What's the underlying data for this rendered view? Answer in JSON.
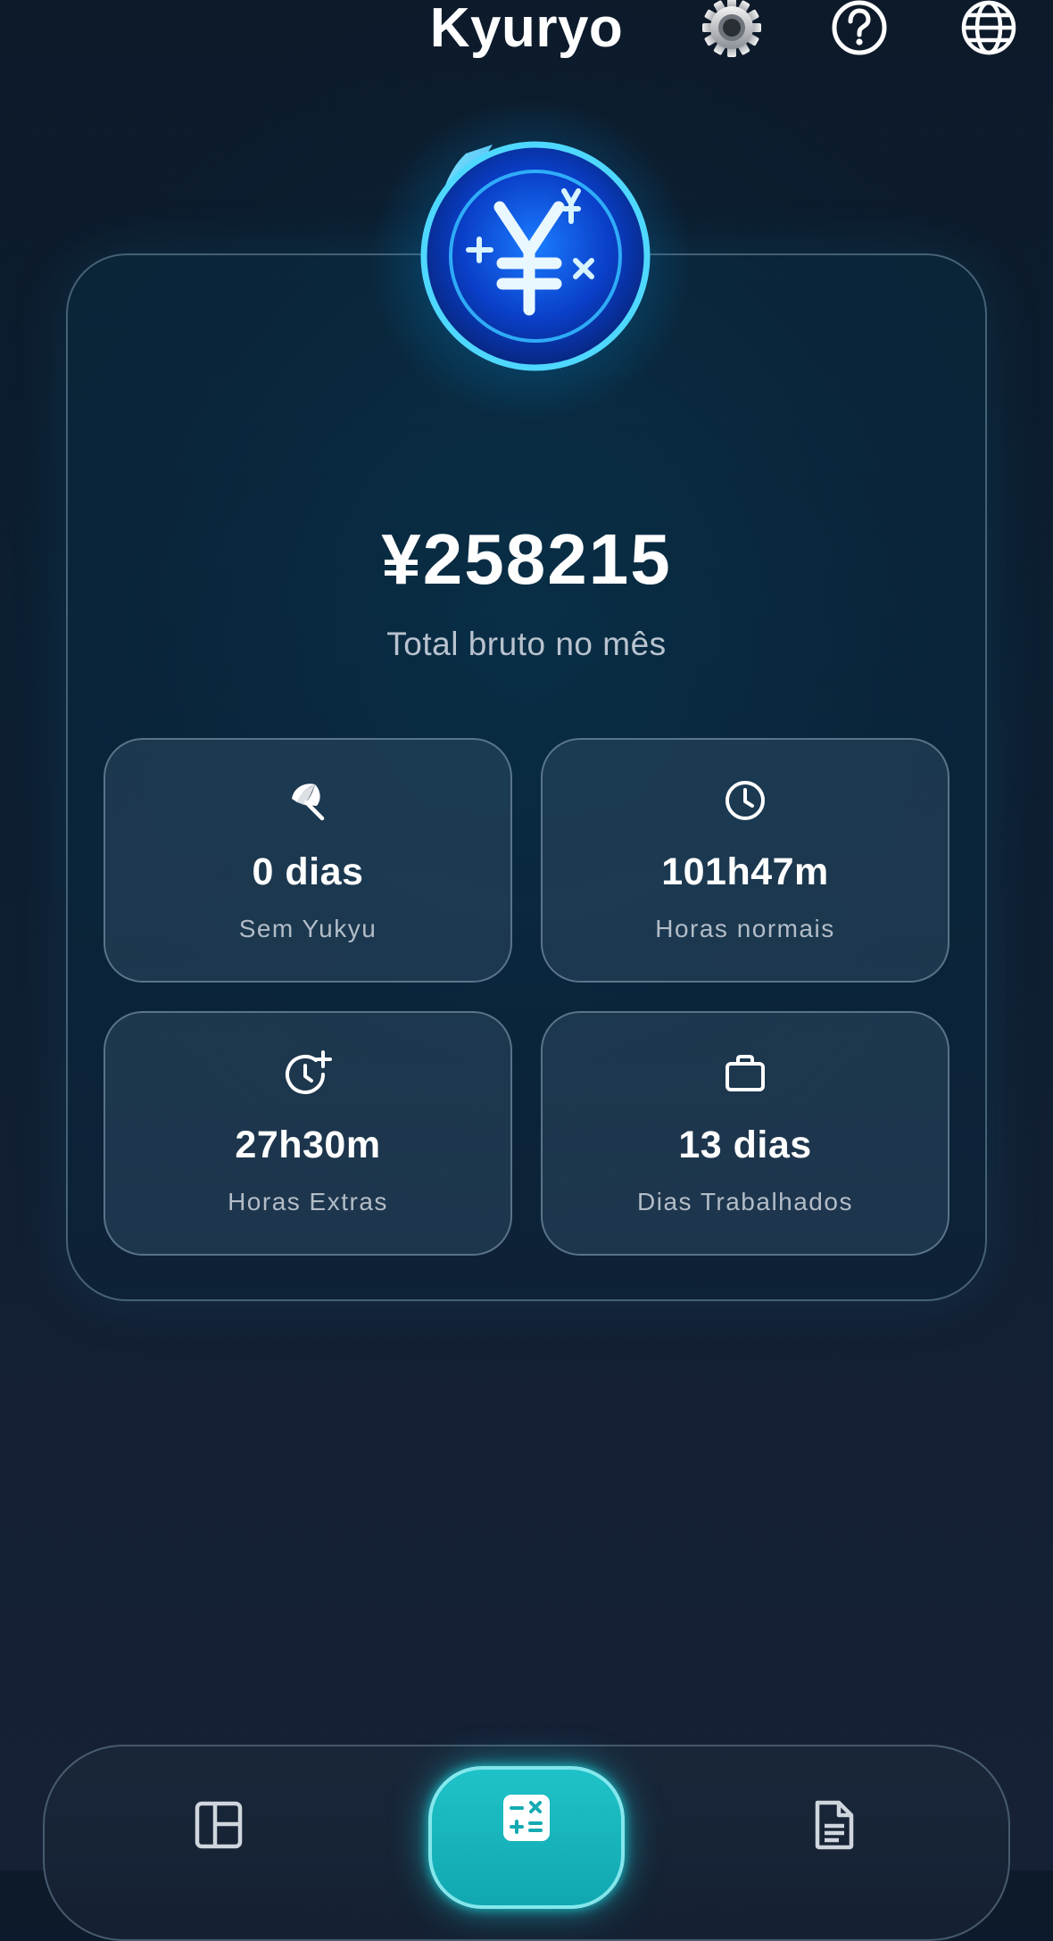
{
  "header": {
    "title": "Kyuryo",
    "icons": [
      "gear-icon",
      "help-circle-icon",
      "globe-icon"
    ]
  },
  "summary": {
    "total_value": "¥258215",
    "total_label": "Total bruto no mês"
  },
  "stats": [
    {
      "icon": "beach-umbrella-icon",
      "value": "0 dias",
      "label": "Sem Yukyu"
    },
    {
      "icon": "clock-icon",
      "value": "101h47m",
      "label": "Horas normais"
    },
    {
      "icon": "clock-plus-icon",
      "value": "27h30m",
      "label": "Horas Extras"
    },
    {
      "icon": "briefcase-icon",
      "value": "13 dias",
      "label": "Dias Trabalhados"
    }
  ],
  "bottom_nav": {
    "items": [
      "dashboard-icon",
      "calculator-icon",
      "document-icon"
    ],
    "active": "calculator-icon"
  },
  "colors": {
    "accent": "#1fc2c8",
    "background": "#0d1a2a",
    "text_primary": "#ffffff",
    "text_secondary": "#b9c3cf"
  }
}
